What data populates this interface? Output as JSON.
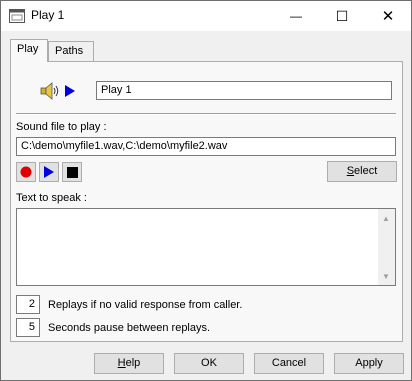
{
  "window": {
    "title": "Play 1",
    "minimize_glyph": "—",
    "maximize_glyph": "☐",
    "close_glyph": "✕"
  },
  "tabs": [
    {
      "label": "Play",
      "active": true
    },
    {
      "label": "Paths",
      "active": false
    }
  ],
  "play": {
    "name_value": "Play 1",
    "speaker_icon": "speaker-icon",
    "play_icon": "play-icon"
  },
  "sound_file": {
    "label": "Sound file to play :",
    "value": "C:\\demo\\myfile1.wav,C:\\demo\\myfile2.wav",
    "select_label_prefix": "",
    "select_accel": "S",
    "select_label_rest": "elect",
    "media_buttons": [
      "record-icon",
      "play-icon",
      "stop-icon"
    ]
  },
  "tts": {
    "label": "Text to speak :",
    "value": ""
  },
  "replays": {
    "count": "2",
    "count_label": "Replays if no valid response from caller.",
    "pause": "5",
    "pause_label": "Seconds pause between replays."
  },
  "footer": {
    "help_accel": "H",
    "help_rest": "elp",
    "ok": "OK",
    "cancel": "Cancel",
    "apply": "Apply"
  },
  "colors": {
    "record": "#e00000",
    "play": "#0000e0",
    "stop": "#000000"
  }
}
